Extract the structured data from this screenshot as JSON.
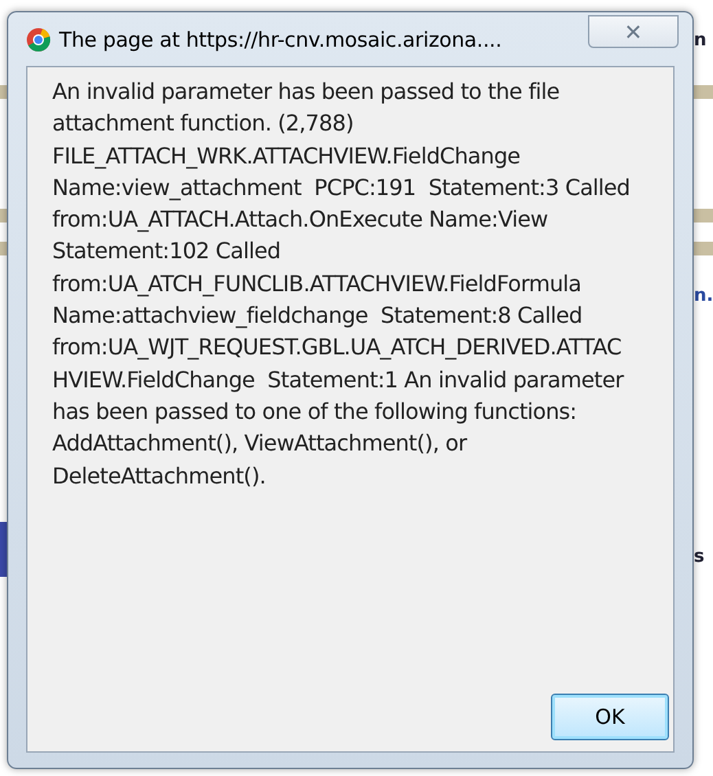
{
  "background_page": {
    "text_fragments": [
      "n",
      "n.",
      "s"
    ]
  },
  "dialog": {
    "title": "The page at https://hr-cnv.mosaic.arizona....",
    "close_glyph": "✕",
    "message": "An invalid parameter has been passed to the file attachment function. (2,788) FILE_ATTACH_WRK.ATTACHVIEW.FieldChange Name:view_attachment  PCPC:191  Statement:3 Called from:UA_ATTACH.Attach.OnExecute Name:View  Statement:102 Called from:UA_ATCH_FUNCLIB.ATTACHVIEW.FieldFormula  Name:attachview_fieldchange  Statement:8 Called from:UA_WJT_REQUEST.GBL.UA_ATCH_DERIVED.ATTACHVIEW.FieldChange  Statement:1 An invalid parameter has been passed to one of the following functions: AddAttachment(), ViewAttachment(), or DeleteAttachment().",
    "buttons": [
      {
        "label": "OK",
        "kind": "default"
      }
    ]
  }
}
